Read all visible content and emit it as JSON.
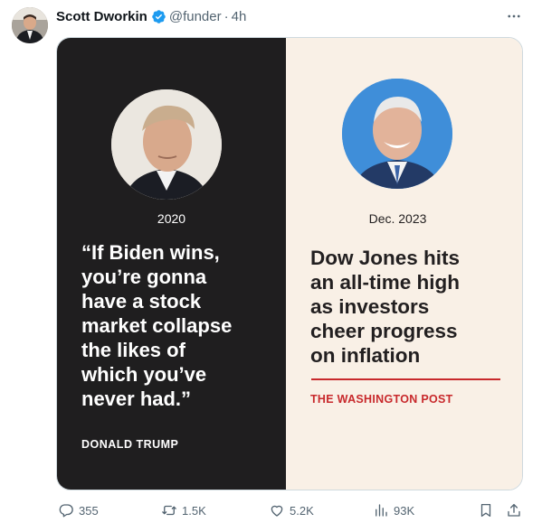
{
  "author": {
    "name": "Scott Dworkin",
    "handle": "@funder",
    "separator": "·",
    "time": "4h"
  },
  "card": {
    "left": {
      "year": "2020",
      "quote_lines": [
        "“If Biden wins,",
        "you’re gonna",
        "have a stock",
        "market collapse",
        "the likes of",
        "which you’ve",
        "never had.”"
      ],
      "attribution": "DONALD TRUMP"
    },
    "right": {
      "date": "Dec. 2023",
      "headline_lines": [
        "Dow Jones hits",
        "an all-time high",
        "as investors",
        "cheer progress",
        "on inflation"
      ],
      "source": "THE WASHINGTON POST"
    }
  },
  "actions": {
    "replies": "355",
    "reposts": "1.5K",
    "likes": "5.2K",
    "views": "93K"
  },
  "colors": {
    "verified": "#1d9bf0",
    "left_panel": "#1f1e1f",
    "right_panel": "#f9f0e6",
    "accent_red": "#c8292c",
    "icon_gray": "#536471"
  },
  "icons": [
    "verified-badge-icon",
    "more-icon",
    "reply-icon",
    "repost-icon",
    "like-icon",
    "views-icon",
    "bookmark-icon",
    "share-icon"
  ]
}
